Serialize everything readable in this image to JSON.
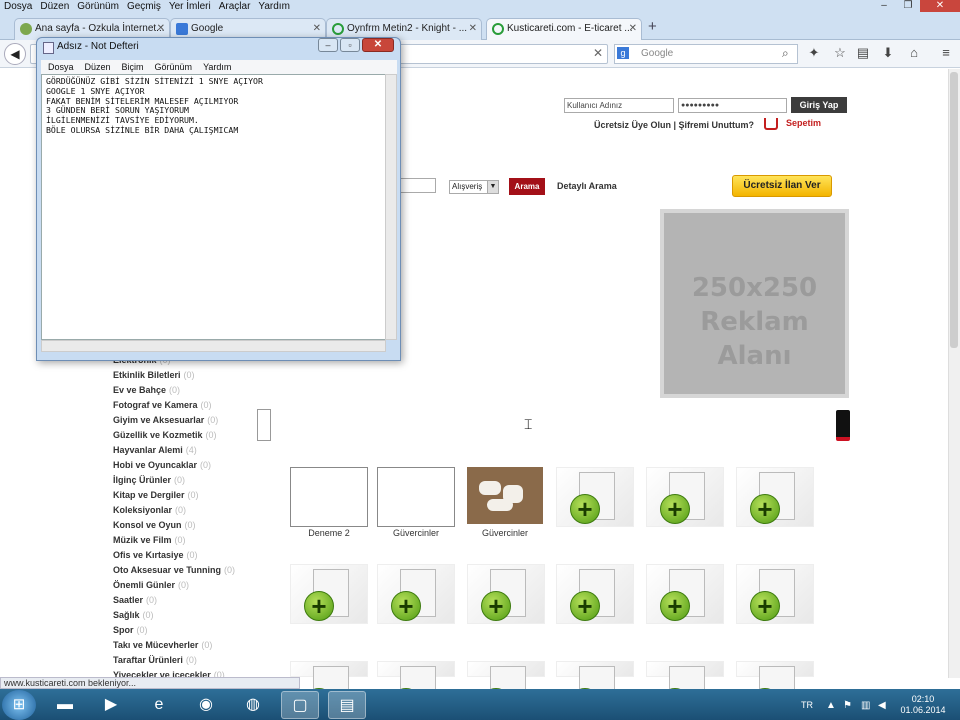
{
  "browser": {
    "menu": [
      "Dosya",
      "Düzen",
      "Görünüm",
      "Geçmiş",
      "Yer İmleri",
      "Araçlar",
      "Yardım"
    ],
    "tabs": [
      {
        "label": "Ana sayfa - Ozkula İnternet..."
      },
      {
        "label": "Google"
      },
      {
        "label": "Oynfrm Metin2 - Knight - ..."
      },
      {
        "label": "Kusticareti.com - E-ticaret ..."
      }
    ],
    "search_placeholder": "Google",
    "status_text": "www.kusticareti.com bekleniyor..."
  },
  "notepad": {
    "title": "Adsız - Not Defteri",
    "menu": [
      "Dosya",
      "Düzen",
      "Biçim",
      "Görünüm",
      "Yardım"
    ],
    "text": "GÖRDÜĞÜNÜZ GİBİ SİZİN SİTENİZİ 1 SNYE AÇIYOR\nGOOGLE 1 SNYE AÇIYOR\nFAKAT BENİM SİTELERİM MALESEF AÇILMIYOR\n3 GÜNDEN BERİ SORUN YAŞIYORUM\nİLGİLENMENİZİ TAVSİYE EDİYORUM.\nBÖLE OLURSA SİZİNLE BİR DAHA ÇALIŞMICAM"
  },
  "site": {
    "login": {
      "username_placeholder": "Kullanıcı Adınız",
      "password_value": "●●●●●●●●●",
      "submit": "Giriş Yap"
    },
    "register_links": "Ücretsiz Üye Olun | Şifremi Unuttum?",
    "cart": "Sepetim",
    "search_type": "Alışveriş",
    "search_button": "Arama",
    "advanced_search": "Detaylı Arama",
    "free_listing": "Ücretsiz İlan Ver",
    "ad": {
      "line1": "250x250",
      "line2": "Reklam Alanı"
    },
    "categories": [
      {
        "name": "Elektronik",
        "count": "(0)"
      },
      {
        "name": "Etkinlik Biletleri",
        "count": "(0)"
      },
      {
        "name": "Ev ve Bahçe",
        "count": "(0)"
      },
      {
        "name": "Fotograf ve Kamera",
        "count": "(0)"
      },
      {
        "name": "Giyim ve Aksesuarlar",
        "count": "(0)"
      },
      {
        "name": "Güzellik ve Kozmetik",
        "count": "(0)"
      },
      {
        "name": "Hayvanlar Alemi",
        "count": "(4)"
      },
      {
        "name": "Hobi ve Oyuncaklar",
        "count": "(0)"
      },
      {
        "name": "İlginç Ürünler",
        "count": "(0)"
      },
      {
        "name": "Kitap ve Dergiler",
        "count": "(0)"
      },
      {
        "name": "Koleksiyonlar",
        "count": "(0)"
      },
      {
        "name": "Konsol ve Oyun",
        "count": "(0)"
      },
      {
        "name": "Müzik ve Film",
        "count": "(0)"
      },
      {
        "name": "Ofis ve Kırtasiye",
        "count": "(0)"
      },
      {
        "name": "Oto Aksesuar ve Tunning",
        "count": "(0)"
      },
      {
        "name": "Önemli Günler",
        "count": "(0)"
      },
      {
        "name": "Saatler",
        "count": "(0)"
      },
      {
        "name": "Sağlık",
        "count": "(0)"
      },
      {
        "name": "Spor",
        "count": "(0)"
      },
      {
        "name": "Takı ve Mücevherler",
        "count": "(0)"
      },
      {
        "name": "Taraftar Ürünleri",
        "count": "(0)"
      },
      {
        "name": "Yiyecekler ve içecekler",
        "count": "(0)"
      }
    ],
    "products": [
      {
        "caption": "Deneme 2"
      },
      {
        "caption": "Güvercinler"
      },
      {
        "caption": "Güvercinler"
      }
    ]
  },
  "taskbar": {
    "lang": "TR",
    "time": "02:10",
    "date": "01.06.2014"
  }
}
